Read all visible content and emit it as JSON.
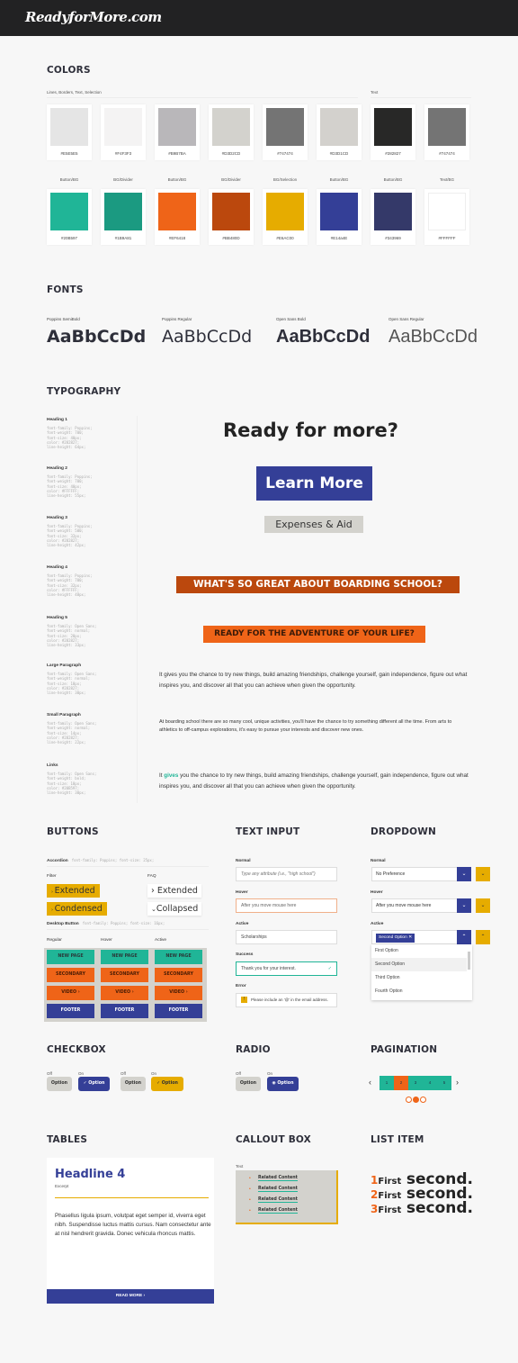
{
  "header": {
    "logo": "ReadyforMore.com"
  },
  "colors": {
    "title": "COLORS",
    "group1_label": "Lines, Borders, Text, Selection",
    "group2_label": "Text",
    "row1": [
      {
        "hex": "#E5E5E5",
        "color": "#E5E5E5"
      },
      {
        "hex": "#F4F3F3",
        "color": "#F4F3F3"
      },
      {
        "hex": "#B9B7BA",
        "color": "#B9B7BA"
      },
      {
        "hex": "#D3D2CD",
        "color": "#D3D2CD"
      },
      {
        "hex": "#747474",
        "color": "#747474"
      },
      {
        "hex": "#D3D1CD",
        "color": "#D3D1CD"
      },
      {
        "hex": "#282827",
        "color": "#282827"
      },
      {
        "hex": "#747474",
        "color": "#747474"
      }
    ],
    "row2": [
      {
        "label": "Button/BG",
        "hex": "#20B597",
        "color": "#20B597"
      },
      {
        "label": "BG/Divider",
        "hex": "#1B9A81",
        "color": "#1B9A81"
      },
      {
        "label": "Button/BG",
        "hex": "#EF6418",
        "color": "#EF6418"
      },
      {
        "label": "BG/Divider",
        "hex": "#BB480D",
        "color": "#BB480D"
      },
      {
        "label": "BG/Selection",
        "hex": "#E6AC00",
        "color": "#E6AC00"
      },
      {
        "label": "Button/BG",
        "hex": "#E14a4E",
        "color": "#343F97"
      },
      {
        "label": "Button/BG",
        "hex": "#343969",
        "color": "#343969"
      },
      {
        "label": "Text/BG",
        "hex": "#FFFFFF",
        "color": "#FFFFFF"
      }
    ]
  },
  "fonts": {
    "title": "FONTS",
    "items": [
      {
        "label": "Poppins SemiBold",
        "sample": "AaBbCcDd"
      },
      {
        "label": "Poppins Regular",
        "sample": "AaBbCcDd"
      },
      {
        "label": "Open Sans Bold",
        "sample": "AaBbCcDd"
      },
      {
        "label": "Open Sans Regular",
        "sample": "AaBbCcDd"
      }
    ]
  },
  "typography": {
    "title": "TYPOGRAPHY",
    "items": [
      {
        "label": "Heading 1",
        "code": "font-family: Poppins;\nfont-weight: 700;\nfont-size: 48px;\ncolor: #282827;\nline-height: 64px;"
      },
      {
        "label": "Heading 2",
        "code": "font-family: Poppins;\nfont-weight: 700;\nfont-size: 40px;\ncolor: #FFFFFF;\nline-height: 55px;"
      },
      {
        "label": "Heading 3",
        "code": "font-family: Poppins;\nfont-weight: 500;\nfont-size: 32px;\ncolor: #282827;\nline-height: 42px;"
      },
      {
        "label": "Heading 4",
        "code": "font-family: Poppins;\nfont-weight: 700;\nfont-size: 32px;\ncolor: #FFFFFF;\nline-height: 48px;"
      },
      {
        "label": "Heading 5",
        "code": "font-family: Open Sans;\nfont-weight: normal;\nfont-size: 28px;\ncolor: #282827;\nline-height: 33px;"
      },
      {
        "label": "Large Paragraph",
        "code": "font-family: Open Sans;\nfont-weight: normal;\nfont-size: 18px;\ncolor: #282827;\nline-height: 30px;"
      },
      {
        "label": "Small Paragraph",
        "code": "font-family: Open Sans;\nfont-weight: normal;\nfont-size: 14px;\ncolor: #282827;\nline-height: 22px;"
      },
      {
        "label": "Links",
        "code": "font-family: Open Sans;\nfont-weight: bold;\nfont-size: 18px;\ncolor: #20B597;\nline-height: 30px;"
      }
    ],
    "samples": {
      "h1": "Ready for more?",
      "h2": "Learn More",
      "h3": "Expenses & Aid",
      "h4": "WHAT'S SO GREAT ABOUT BOARDING SCHOOL?",
      "h5": "READY FOR THE ADVENTURE OF YOUR LIFE?",
      "large_paragraph": "It gives you the chance to try new things, build amazing friendships, challenge yourself, gain independence, figure out what inspires you, and discover all that you can achieve when given the opportunity.",
      "small_paragraph": "At boarding school there are so many cool, unique activities, you'll have the chance to try something different all the time. From arts to athletics to off-campus explorations, it's easy to pursue your interests and discover new ones.",
      "link_pre": "It ",
      "link_word": "gives",
      "link_post": " you the chance to try new things, build amazing friendships, challenge yourself, gain independence, figure out what inspires you, and discover all that you can achieve when given the opportunity."
    }
  },
  "buttons": {
    "title": "BUTTONS",
    "accordion_label": "Accordion",
    "accordion_code": "font-family: Poppins; font-size: 25px;",
    "filter_label": "Filter",
    "faq_label": "FAQ",
    "filter_extended": "Extended",
    "filter_condensed": "Condensed",
    "faq_extended": "Extended",
    "faq_collapsed": "Collapsed",
    "desktop_label": "Desktop Button",
    "desktop_code": "font-family: Poppins; font-size: 16px;",
    "states": [
      "Regular",
      "Hover",
      "Active"
    ],
    "labels": [
      "NEW PAGE",
      "SECONDARY",
      "VIDEO ›",
      "FOOTER"
    ]
  },
  "text_input": {
    "title": "TEXT INPUT",
    "normal_label": "Normal",
    "normal_placeholder": "Type any attribute (i.e., \"high school\")",
    "hover_label": "Hover",
    "hover_value": "After you move mouse here",
    "active_label": "Active",
    "active_value": "Scholarships",
    "success_label": "Success",
    "success_value": "Thank you for your interest.",
    "error_label": "Error",
    "error_value": "Please include an '@' in the email address."
  },
  "dropdown": {
    "title": "DROPDOWN",
    "normal_label": "Normal",
    "normal_value": "No Preference",
    "hover_label": "Hover",
    "hover_value": "After you move mouse here",
    "active_label": "Active",
    "active_tag": "Second Option",
    "options": [
      "First Option",
      "Second Option",
      "Third Option",
      "Fourth Option"
    ],
    "selected_index": 1
  },
  "checkbox": {
    "title": "CHECKBOX",
    "off": "Off",
    "on": "On",
    "option": "Option"
  },
  "radio": {
    "title": "RADIO",
    "off": "Off",
    "on": "On",
    "option": "Option"
  },
  "pagination": {
    "title": "PAGINATION",
    "pages": [
      "1",
      "2",
      "3",
      "4",
      "5"
    ],
    "current": 2,
    "prev": "‹",
    "next": "›",
    "dots_active": 2
  },
  "tables": {
    "title": "TABLES",
    "headline": "Headline 4",
    "excerpt": "Excerpt",
    "body": "Phasellus ligula ipsum, volutpat eget semper id, viverra eget nibh. Suspendisse luctus mattis cursus. Nam consectetur ante at nisl hendrerit gravida. Donec vehicula rhoncus mattis.",
    "button": "READ MORE ›"
  },
  "callout": {
    "title": "CALLOUT BOX",
    "label": "Text",
    "items": [
      "Related Content",
      "Related Content",
      "Related Content",
      "Related Content"
    ]
  },
  "list_item": {
    "title": "LIST ITEM",
    "items": [
      {
        "num": "1",
        "first": "First",
        "second": "second."
      },
      {
        "num": "2",
        "first": "First",
        "second": "second."
      },
      {
        "num": "3",
        "first": "First",
        "second": "second."
      }
    ]
  }
}
